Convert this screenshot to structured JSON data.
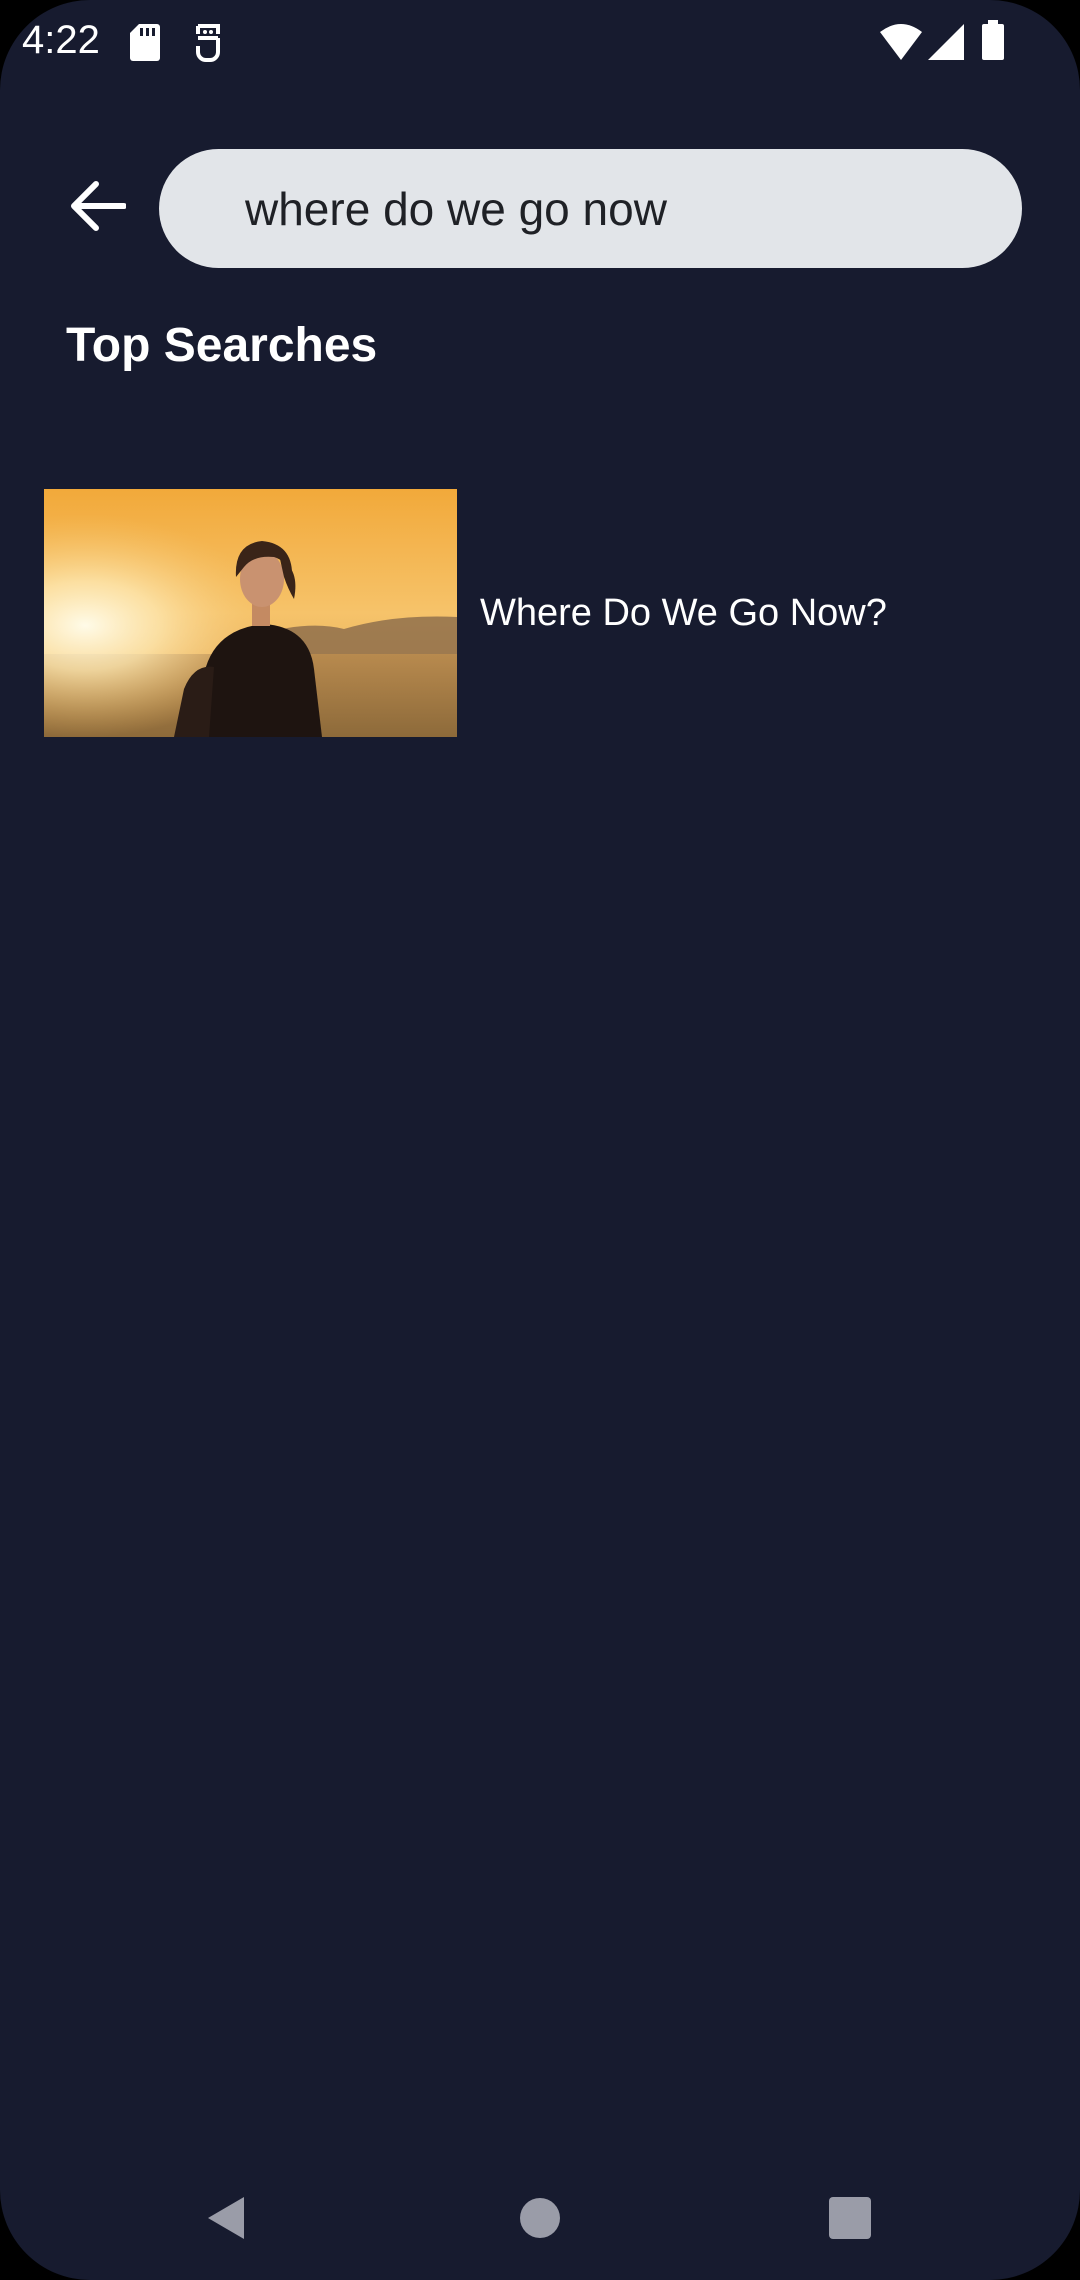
{
  "status_bar": {
    "time": "4:22",
    "icons_left": [
      "sd-card-icon",
      "notification-app-icon"
    ],
    "icons_right": [
      "wifi-icon",
      "signal-icon",
      "battery-icon"
    ]
  },
  "search": {
    "value": "where do we go now",
    "back_icon": "arrow-left-icon"
  },
  "section": {
    "title": "Top Searches"
  },
  "results": [
    {
      "title": "Where Do We Go Now?",
      "thumbnail": "movie-poster-woman-desert-sunset"
    }
  ],
  "nav": {
    "buttons": [
      "back-triangle-icon",
      "home-circle-icon",
      "recents-square-icon"
    ]
  },
  "colors": {
    "background": "#171b2f",
    "search_field": "#e2e5e9",
    "nav_icons": "#9a9ca8"
  }
}
